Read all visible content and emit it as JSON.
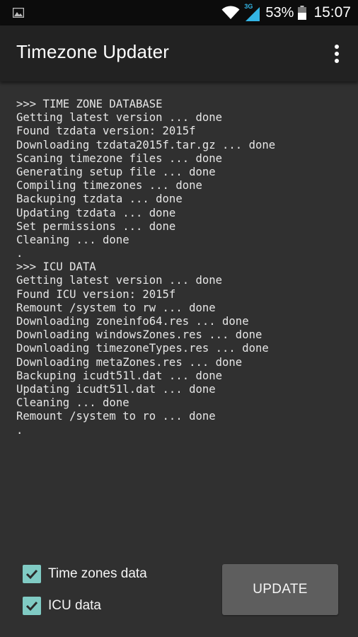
{
  "status_bar": {
    "left_icon": "image-notification-icon",
    "network_type": "3G",
    "battery_percent": "53%",
    "time": "15:07"
  },
  "app_bar": {
    "title": "Timezone Updater",
    "menu_icon": "overflow-menu-icon"
  },
  "log": {
    "lines": [
      ">>> TIME ZONE DATABASE",
      "Getting latest version ... done",
      "Found tzdata version: 2015f",
      "Downloading tzdata2015f.tar.gz ... done",
      "Scaning timezone files ... done",
      "Generating setup file ... done",
      "Compiling timezones ... done",
      "Backuping tzdata ... done",
      "Updating tzdata ... done",
      "Set permissions ... done",
      "Cleaning ... done",
      ".",
      ">>> ICU DATA",
      "Getting latest version ... done",
      "Found ICU version: 2015f",
      "Remount /system to rw ... done",
      "Downloading zoneinfo64.res ... done",
      "Downloading windowsZones.res ... done",
      "Downloading timezoneTypes.res ... done",
      "Downloading metaZones.res ... done",
      "Backuping icudt51l.dat ... done",
      "Updating icudt51l.dat ... done",
      "Cleaning ... done",
      "Remount /system to ro ... done",
      "."
    ]
  },
  "options": [
    {
      "label": "Time zones data",
      "checked": true
    },
    {
      "label": "ICU data",
      "checked": true
    }
  ],
  "update_button": {
    "label": "UPDATE"
  },
  "colors": {
    "background": "#303030",
    "app_bar": "#222222",
    "checkbox": "#80cbc4",
    "button": "#5e5e5e"
  }
}
